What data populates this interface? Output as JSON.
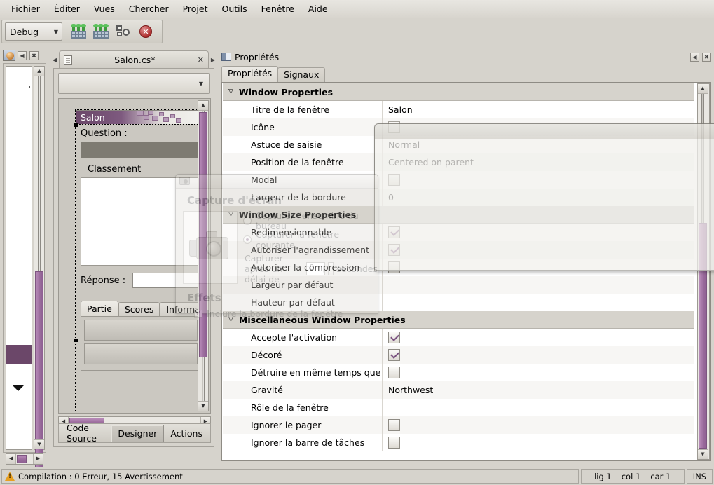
{
  "menubar": {
    "items": [
      {
        "label": "Fichier",
        "mnemonic": "F"
      },
      {
        "label": "Éditer",
        "mnemonic": "É"
      },
      {
        "label": "Vues",
        "mnemonic": "V"
      },
      {
        "label": "Chercher",
        "mnemonic": "C"
      },
      {
        "label": "Projet",
        "mnemonic": "P"
      },
      {
        "label": "Outils",
        "mnemonic": "O"
      },
      {
        "label": "Fenêtre",
        "mnemonic": "F"
      },
      {
        "label": "Aide",
        "mnemonic": "A"
      }
    ]
  },
  "toolbar": {
    "configuration": "Debug",
    "dropdown_arrow": "▼",
    "buttons": [
      {
        "name": "build-button",
        "icon": "build-icon",
        "label": "Compiler"
      },
      {
        "name": "rebuild-button",
        "icon": "rebuild-icon",
        "label": "Recompiler"
      },
      {
        "name": "run-button",
        "icon": "gears-icon",
        "label": "Exécuter"
      },
      {
        "name": "stop-button",
        "icon": "stop-icon",
        "label": "Arrêter"
      }
    ],
    "stop_glyph": "✕"
  },
  "toolbox": {
    "icon": "palette-icon",
    "minimize_glyph": "◀",
    "close_glyph": "✖"
  },
  "document": {
    "prev_glyph": "◀",
    "next_glyph": "▶",
    "tab": {
      "label": "Salon.cs*",
      "icon": "file-icon",
      "close_glyph": "✕"
    },
    "combo_arrow": "▼",
    "view_tabs": [
      {
        "label": "Code Source",
        "active": false
      },
      {
        "label": "Designer",
        "active": true
      },
      {
        "label": "Actions",
        "active": false
      }
    ]
  },
  "designer_form": {
    "title": "Salon",
    "question_label": "Question :",
    "classement_label": "Classement",
    "reponse_label": "Réponse :",
    "reponse_value": "",
    "notebook_tabs": [
      {
        "label": "Partie",
        "active": true
      },
      {
        "label": "Scores",
        "active": false
      },
      {
        "label": "Information",
        "active": false
      }
    ]
  },
  "screenshot_dialog": {
    "heading": "Capture d'écran",
    "camera_icon": "camera-icon",
    "options": [
      {
        "label": "Capturer l'ensemble du bureau",
        "selected": false
      },
      {
        "label": "Capturer la fenêtre courante",
        "selected": true
      }
    ],
    "delay_prefix": "Capturer après un délai de",
    "delay_value": "0",
    "delay_suffix": "secondes",
    "effects_heading": "Effets",
    "border_option": {
      "label": "Inclure la bordure de la fenêtre",
      "checked": true
    }
  },
  "properties_pane": {
    "icon": "properties-icon",
    "title": "Propriétés",
    "minimize_glyph": "◀",
    "close_glyph": "✖",
    "tabs": [
      {
        "label": "Propriétés",
        "active": true
      },
      {
        "label": "Signaux",
        "active": false
      }
    ],
    "groups": [
      {
        "name": "Window Properties",
        "collapse_glyph": "▽",
        "rows": [
          {
            "key": "Titre de la fenêtre",
            "type": "text",
            "value": "Salon"
          },
          {
            "key": "Icône",
            "type": "image",
            "value": ""
          },
          {
            "key": "Astuce de saisie",
            "type": "text",
            "value": "Normal"
          },
          {
            "key": "Position de la fenêtre",
            "type": "text",
            "value": "Centered on parent"
          },
          {
            "key": "Modal",
            "type": "checkbox",
            "checked": false
          },
          {
            "key": "Largeur de la bordure",
            "type": "text",
            "value": "0"
          }
        ]
      },
      {
        "name": "Window Size Properties",
        "collapse_glyph": "▽",
        "rows": [
          {
            "key": "Redimensionnable",
            "type": "checkbox",
            "checked": true
          },
          {
            "key": "Autoriser l'agrandissement",
            "type": "checkbox",
            "checked": true
          },
          {
            "key": "Autoriser la compression",
            "type": "checkbox",
            "checked": false
          },
          {
            "key": "Largeur par défaut",
            "type": "text",
            "value": ""
          },
          {
            "key": "Hauteur par défaut",
            "type": "text",
            "value": ""
          }
        ]
      },
      {
        "name": "Miscellaneous Window Properties",
        "collapse_glyph": "▽",
        "rows": [
          {
            "key": "Accepte l'activation",
            "type": "checkbox",
            "checked": true
          },
          {
            "key": "Décoré",
            "type": "checkbox",
            "checked": true
          },
          {
            "key": "Détruire en même temps que",
            "type": "checkbox",
            "checked": false
          },
          {
            "key": "Gravité",
            "type": "text",
            "value": "Northwest"
          },
          {
            "key": "Rôle de la fenêtre",
            "type": "text",
            "value": ""
          },
          {
            "key": "Ignorer le pager",
            "type": "checkbox",
            "checked": false
          },
          {
            "key": "Ignorer la barre de tâches",
            "type": "checkbox",
            "checked": false
          }
        ]
      }
    ]
  },
  "floating_dialog": {
    "close_glyph": "✕"
  },
  "statusbar": {
    "icon": "warning-icon",
    "message": "Compilation : 0 Erreur, 15 Avertissement",
    "line": "lig 1",
    "column": "col 1",
    "char": "car 1",
    "mode": "INS"
  },
  "scroll_glyphs": {
    "up": "▲",
    "down": "▼",
    "left": "◀",
    "right": "▶"
  },
  "colors": {
    "accent_purple": "#6b4769",
    "scrollbar_purple": "#9a6b9c",
    "chrome_grey": "#d6d3cc",
    "group_header": "#d6d3cc",
    "warning_orange": "#e8a020"
  }
}
